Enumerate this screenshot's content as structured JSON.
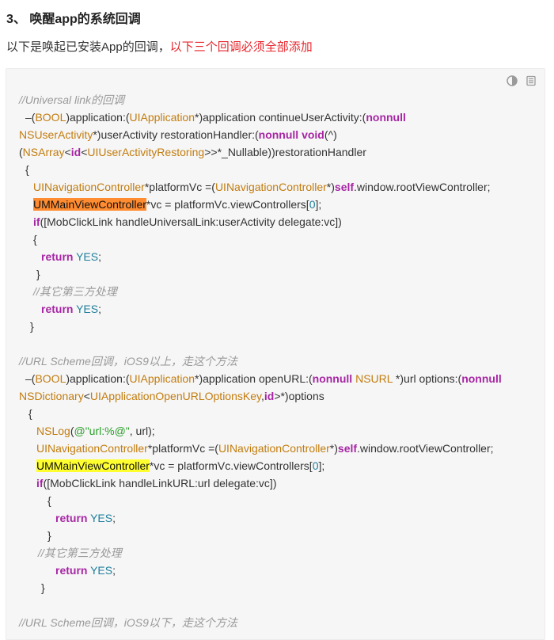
{
  "heading": "3、 唤醒app的系统回调",
  "intro": {
    "plain": "以下是唤起已安装App的回调，",
    "emphasis": "以下三个回调必须全部添加",
    "emphasis_color": "#e8262d"
  },
  "toolbar": {
    "icons": [
      "theme-toggle-icon",
      "copy-icon"
    ]
  },
  "code_lines": [
    {
      "indent": 16,
      "segs": [
        [
          "cm",
          "//Universal link的回调"
        ]
      ]
    },
    {
      "indent": 24,
      "segs": [
        [
          "",
          "–("
        ],
        [
          "ty",
          "BOOL"
        ],
        [
          "",
          ")application:("
        ],
        [
          "ty",
          "UIApplication"
        ],
        [
          "",
          "*)application continueUserActivity:("
        ],
        [
          "kw",
          "nonnull"
        ]
      ]
    },
    {
      "indent": 16,
      "segs": [
        [
          "ty",
          "NSUserActivity"
        ],
        [
          "",
          "*)userActivity restorationHandler:("
        ],
        [
          "kw",
          "nonnull void"
        ],
        [
          "",
          "(^)"
        ]
      ]
    },
    {
      "indent": 16,
      "segs": [
        [
          "",
          "("
        ],
        [
          "ty",
          "NSArray"
        ],
        [
          "",
          "<"
        ],
        [
          "kw",
          "id"
        ],
        [
          "",
          "<"
        ],
        [
          "ty",
          "UIUserActivityRestoring"
        ],
        [
          "",
          ">>*_Nullable))restorationHandler"
        ]
      ]
    },
    {
      "indent": 24,
      "segs": [
        [
          "",
          "{"
        ]
      ]
    },
    {
      "indent": 34,
      "segs": [
        [
          "ty",
          "UINavigationController"
        ],
        [
          "",
          "*platformVc =("
        ],
        [
          "ty",
          "UINavigationController"
        ],
        [
          "",
          "*)"
        ],
        [
          "kw",
          "self"
        ],
        [
          "",
          ".window.rootViewController;"
        ]
      ]
    },
    {
      "indent": 34,
      "segs": [
        [
          "hl-o",
          "UMMainViewController"
        ],
        [
          "",
          "*vc = platformVc.viewControllers["
        ],
        [
          "nb",
          "0"
        ],
        [
          "",
          "];"
        ]
      ]
    },
    {
      "indent": 34,
      "segs": [
        [
          "kw",
          "if"
        ],
        [
          "",
          "([MobClickLink handleUniversalLink:userActivity delegate:vc])"
        ]
      ]
    },
    {
      "indent": 34,
      "segs": [
        [
          "",
          "{"
        ]
      ]
    },
    {
      "indent": 44,
      "segs": [
        [
          "kw",
          "return"
        ],
        [
          "",
          " "
        ],
        [
          "nb",
          "YES"
        ],
        [
          "",
          ";"
        ]
      ]
    },
    {
      "indent": 38,
      "segs": [
        [
          "",
          "}"
        ]
      ]
    },
    {
      "indent": 34,
      "segs": [
        [
          "cm",
          "//其它第三方处理"
        ]
      ]
    },
    {
      "indent": 44,
      "segs": [
        [
          "kw",
          "return"
        ],
        [
          "",
          " "
        ],
        [
          "nb",
          "YES"
        ],
        [
          "",
          ";"
        ]
      ]
    },
    {
      "indent": 30,
      "segs": [
        [
          "",
          "}"
        ]
      ]
    },
    {
      "indent": 16,
      "segs": []
    },
    {
      "indent": 16,
      "segs": [
        [
          "cm",
          "//URL Scheme回调，iOS9以上，走这个方法"
        ]
      ]
    },
    {
      "indent": 24,
      "segs": [
        [
          "",
          "–("
        ],
        [
          "ty",
          "BOOL"
        ],
        [
          "",
          ")application:("
        ],
        [
          "ty",
          "UIApplication"
        ],
        [
          "",
          "*)application openURL:("
        ],
        [
          "kw",
          "nonnull"
        ],
        [
          "",
          " "
        ],
        [
          "ty",
          "NSURL"
        ],
        [
          "",
          " *)url options:("
        ],
        [
          "kw",
          "nonnull"
        ]
      ]
    },
    {
      "indent": 16,
      "segs": [
        [
          "ty",
          "NSDictionary"
        ],
        [
          "",
          "<"
        ],
        [
          "ty",
          "UIApplicationOpenURLOptionsKey"
        ],
        [
          "",
          ","
        ],
        [
          "kw",
          "id"
        ],
        [
          "",
          ">*)options"
        ]
      ]
    },
    {
      "indent": 28,
      "segs": [
        [
          "",
          "{"
        ]
      ]
    },
    {
      "indent": 38,
      "segs": [
        [
          "ty",
          "NSLog"
        ],
        [
          "",
          "("
        ],
        [
          "st",
          "@\"url:%@\""
        ],
        [
          "",
          ", url);"
        ]
      ]
    },
    {
      "indent": 38,
      "segs": [
        [
          "ty",
          "UINavigationController"
        ],
        [
          "",
          "*platformVc =("
        ],
        [
          "ty",
          "UINavigationController"
        ],
        [
          "",
          "*)"
        ],
        [
          "kw",
          "self"
        ],
        [
          "",
          ".window.rootViewController;"
        ]
      ]
    },
    {
      "indent": 38,
      "segs": [
        [
          "hl-y",
          "UMMainViewController"
        ],
        [
          "",
          "*vc = platformVc.viewControllers["
        ],
        [
          "nb",
          "0"
        ],
        [
          "",
          "];"
        ]
      ]
    },
    {
      "indent": 38,
      "segs": [
        [
          "kw",
          "if"
        ],
        [
          "",
          "([MobClickLink handleLinkURL:url delegate:vc])"
        ]
      ]
    },
    {
      "indent": 52,
      "segs": [
        [
          "",
          "{"
        ]
      ]
    },
    {
      "indent": 62,
      "segs": [
        [
          "kw",
          "return"
        ],
        [
          "",
          " "
        ],
        [
          "nb",
          "YES"
        ],
        [
          "",
          ";"
        ]
      ]
    },
    {
      "indent": 52,
      "segs": [
        [
          "",
          "}"
        ]
      ]
    },
    {
      "indent": 40,
      "segs": [
        [
          "cm",
          "//其它第三方处理"
        ]
      ]
    },
    {
      "indent": 62,
      "segs": [
        [
          "kw",
          "return"
        ],
        [
          "",
          " "
        ],
        [
          "nb",
          "YES"
        ],
        [
          "",
          ";"
        ]
      ]
    },
    {
      "indent": 44,
      "segs": [
        [
          "",
          "}"
        ]
      ]
    },
    {
      "indent": 16,
      "segs": []
    },
    {
      "indent": 16,
      "segs": [
        [
          "cm",
          "//URL Scheme回调，iOS9以下，走这个方法"
        ]
      ]
    }
  ]
}
